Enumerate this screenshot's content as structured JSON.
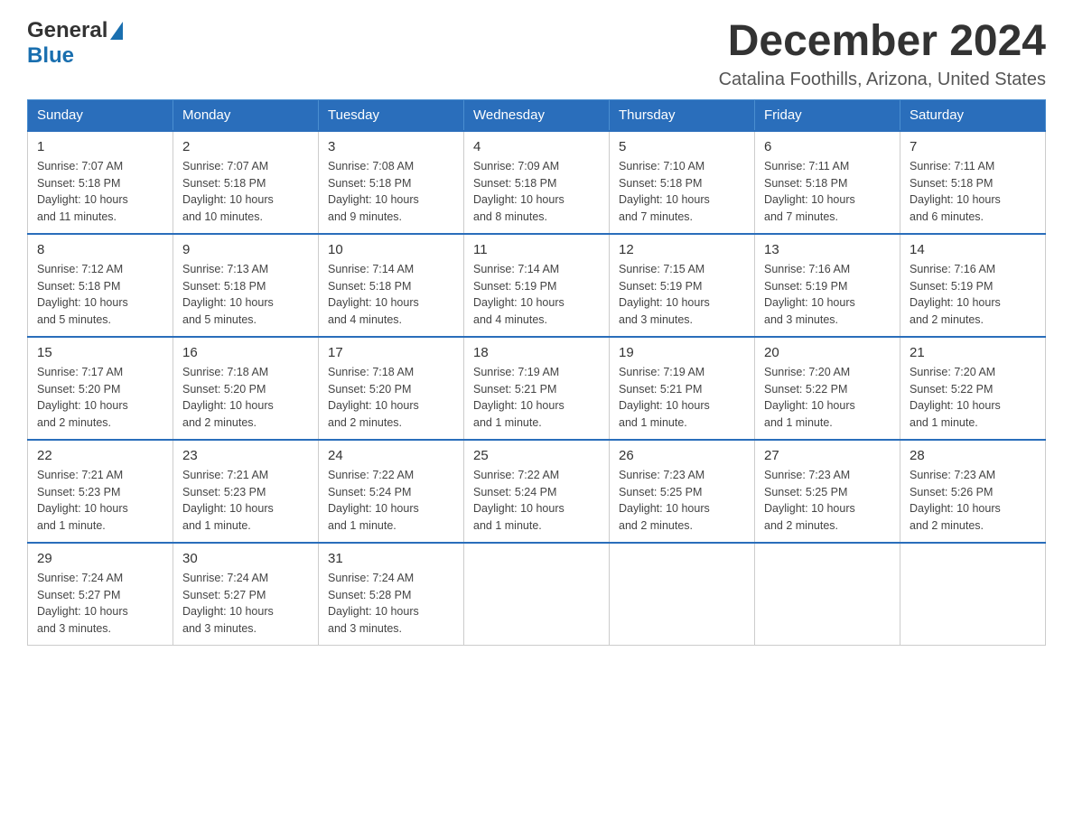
{
  "logo": {
    "general": "General",
    "blue": "Blue"
  },
  "header": {
    "month": "December 2024",
    "location": "Catalina Foothills, Arizona, United States"
  },
  "weekdays": [
    "Sunday",
    "Monday",
    "Tuesday",
    "Wednesday",
    "Thursday",
    "Friday",
    "Saturday"
  ],
  "weeks": [
    [
      {
        "day": "1",
        "sunrise": "7:07 AM",
        "sunset": "5:18 PM",
        "daylight": "10 hours and 11 minutes."
      },
      {
        "day": "2",
        "sunrise": "7:07 AM",
        "sunset": "5:18 PM",
        "daylight": "10 hours and 10 minutes."
      },
      {
        "day": "3",
        "sunrise": "7:08 AM",
        "sunset": "5:18 PM",
        "daylight": "10 hours and 9 minutes."
      },
      {
        "day": "4",
        "sunrise": "7:09 AM",
        "sunset": "5:18 PM",
        "daylight": "10 hours and 8 minutes."
      },
      {
        "day": "5",
        "sunrise": "7:10 AM",
        "sunset": "5:18 PM",
        "daylight": "10 hours and 7 minutes."
      },
      {
        "day": "6",
        "sunrise": "7:11 AM",
        "sunset": "5:18 PM",
        "daylight": "10 hours and 7 minutes."
      },
      {
        "day": "7",
        "sunrise": "7:11 AM",
        "sunset": "5:18 PM",
        "daylight": "10 hours and 6 minutes."
      }
    ],
    [
      {
        "day": "8",
        "sunrise": "7:12 AM",
        "sunset": "5:18 PM",
        "daylight": "10 hours and 5 minutes."
      },
      {
        "day": "9",
        "sunrise": "7:13 AM",
        "sunset": "5:18 PM",
        "daylight": "10 hours and 5 minutes."
      },
      {
        "day": "10",
        "sunrise": "7:14 AM",
        "sunset": "5:18 PM",
        "daylight": "10 hours and 4 minutes."
      },
      {
        "day": "11",
        "sunrise": "7:14 AM",
        "sunset": "5:19 PM",
        "daylight": "10 hours and 4 minutes."
      },
      {
        "day": "12",
        "sunrise": "7:15 AM",
        "sunset": "5:19 PM",
        "daylight": "10 hours and 3 minutes."
      },
      {
        "day": "13",
        "sunrise": "7:16 AM",
        "sunset": "5:19 PM",
        "daylight": "10 hours and 3 minutes."
      },
      {
        "day": "14",
        "sunrise": "7:16 AM",
        "sunset": "5:19 PM",
        "daylight": "10 hours and 2 minutes."
      }
    ],
    [
      {
        "day": "15",
        "sunrise": "7:17 AM",
        "sunset": "5:20 PM",
        "daylight": "10 hours and 2 minutes."
      },
      {
        "day": "16",
        "sunrise": "7:18 AM",
        "sunset": "5:20 PM",
        "daylight": "10 hours and 2 minutes."
      },
      {
        "day": "17",
        "sunrise": "7:18 AM",
        "sunset": "5:20 PM",
        "daylight": "10 hours and 2 minutes."
      },
      {
        "day": "18",
        "sunrise": "7:19 AM",
        "sunset": "5:21 PM",
        "daylight": "10 hours and 1 minute."
      },
      {
        "day": "19",
        "sunrise": "7:19 AM",
        "sunset": "5:21 PM",
        "daylight": "10 hours and 1 minute."
      },
      {
        "day": "20",
        "sunrise": "7:20 AM",
        "sunset": "5:22 PM",
        "daylight": "10 hours and 1 minute."
      },
      {
        "day": "21",
        "sunrise": "7:20 AM",
        "sunset": "5:22 PM",
        "daylight": "10 hours and 1 minute."
      }
    ],
    [
      {
        "day": "22",
        "sunrise": "7:21 AM",
        "sunset": "5:23 PM",
        "daylight": "10 hours and 1 minute."
      },
      {
        "day": "23",
        "sunrise": "7:21 AM",
        "sunset": "5:23 PM",
        "daylight": "10 hours and 1 minute."
      },
      {
        "day": "24",
        "sunrise": "7:22 AM",
        "sunset": "5:24 PM",
        "daylight": "10 hours and 1 minute."
      },
      {
        "day": "25",
        "sunrise": "7:22 AM",
        "sunset": "5:24 PM",
        "daylight": "10 hours and 1 minute."
      },
      {
        "day": "26",
        "sunrise": "7:23 AM",
        "sunset": "5:25 PM",
        "daylight": "10 hours and 2 minutes."
      },
      {
        "day": "27",
        "sunrise": "7:23 AM",
        "sunset": "5:25 PM",
        "daylight": "10 hours and 2 minutes."
      },
      {
        "day": "28",
        "sunrise": "7:23 AM",
        "sunset": "5:26 PM",
        "daylight": "10 hours and 2 minutes."
      }
    ],
    [
      {
        "day": "29",
        "sunrise": "7:24 AM",
        "sunset": "5:27 PM",
        "daylight": "10 hours and 3 minutes."
      },
      {
        "day": "30",
        "sunrise": "7:24 AM",
        "sunset": "5:27 PM",
        "daylight": "10 hours and 3 minutes."
      },
      {
        "day": "31",
        "sunrise": "7:24 AM",
        "sunset": "5:28 PM",
        "daylight": "10 hours and 3 minutes."
      },
      null,
      null,
      null,
      null
    ]
  ],
  "labels": {
    "sunrise": "Sunrise:",
    "sunset": "Sunset:",
    "daylight": "Daylight:"
  }
}
